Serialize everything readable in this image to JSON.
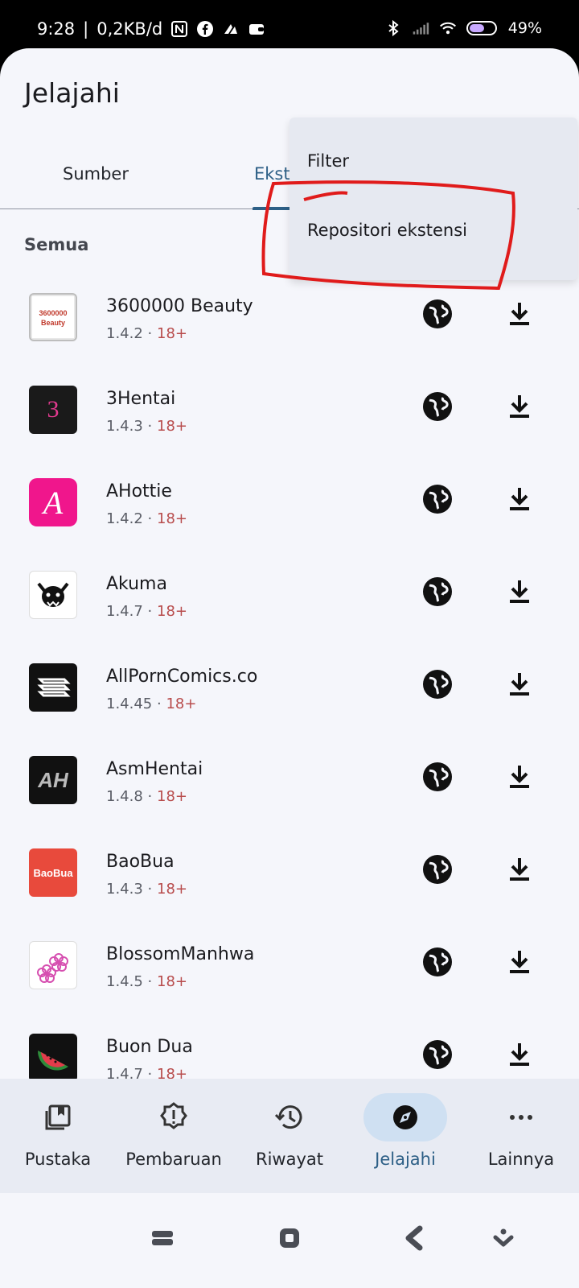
{
  "status_bar": {
    "time": "9:28",
    "speed": "0,2KB/d",
    "battery": "49%"
  },
  "header": {
    "title": "Jelajahi"
  },
  "tabs": [
    {
      "label": "Sumber"
    },
    {
      "label": "Ekst"
    }
  ],
  "section": {
    "label": "Semua"
  },
  "menu": {
    "items": [
      {
        "label": "Filter"
      },
      {
        "label": "Repositori ekstensi"
      }
    ]
  },
  "extensions": [
    {
      "name": "3600000 Beauty",
      "version": "1.4.2",
      "nsfw": "18+",
      "icon_text": "3600000\nBeauty"
    },
    {
      "name": "3Hentai",
      "version": "1.4.3",
      "nsfw": "18+",
      "icon_text": "3"
    },
    {
      "name": "AHottie",
      "version": "1.4.2",
      "nsfw": "18+",
      "icon_text": "A"
    },
    {
      "name": "Akuma",
      "version": "1.4.7",
      "nsfw": "18+",
      "icon_text": ""
    },
    {
      "name": "AllPornComics.co",
      "version": "1.4.45",
      "nsfw": "18+",
      "icon_text": ""
    },
    {
      "name": "AsmHentai",
      "version": "1.4.8",
      "nsfw": "18+",
      "icon_text": "AH"
    },
    {
      "name": "BaoBua",
      "version": "1.4.3",
      "nsfw": "18+",
      "icon_text": "BaoBua"
    },
    {
      "name": "BlossomManhwa",
      "version": "1.4.5",
      "nsfw": "18+",
      "icon_text": ""
    },
    {
      "name": "Buon Dua",
      "version": "1.4.7",
      "nsfw": "18+",
      "icon_text": ""
    }
  ],
  "separator": "·",
  "bottom_nav": [
    {
      "label": "Pustaka",
      "icon": "library-icon"
    },
    {
      "label": "Pembaruan",
      "icon": "updates-icon"
    },
    {
      "label": "Riwayat",
      "icon": "history-icon"
    },
    {
      "label": "Jelajahi",
      "icon": "explore-icon",
      "active": true
    },
    {
      "label": "Lainnya",
      "icon": "more-icon"
    }
  ],
  "colors": {
    "accent": "#2d5f86",
    "nsfw": "#b84c4c",
    "annotation": "#e01b1b"
  }
}
